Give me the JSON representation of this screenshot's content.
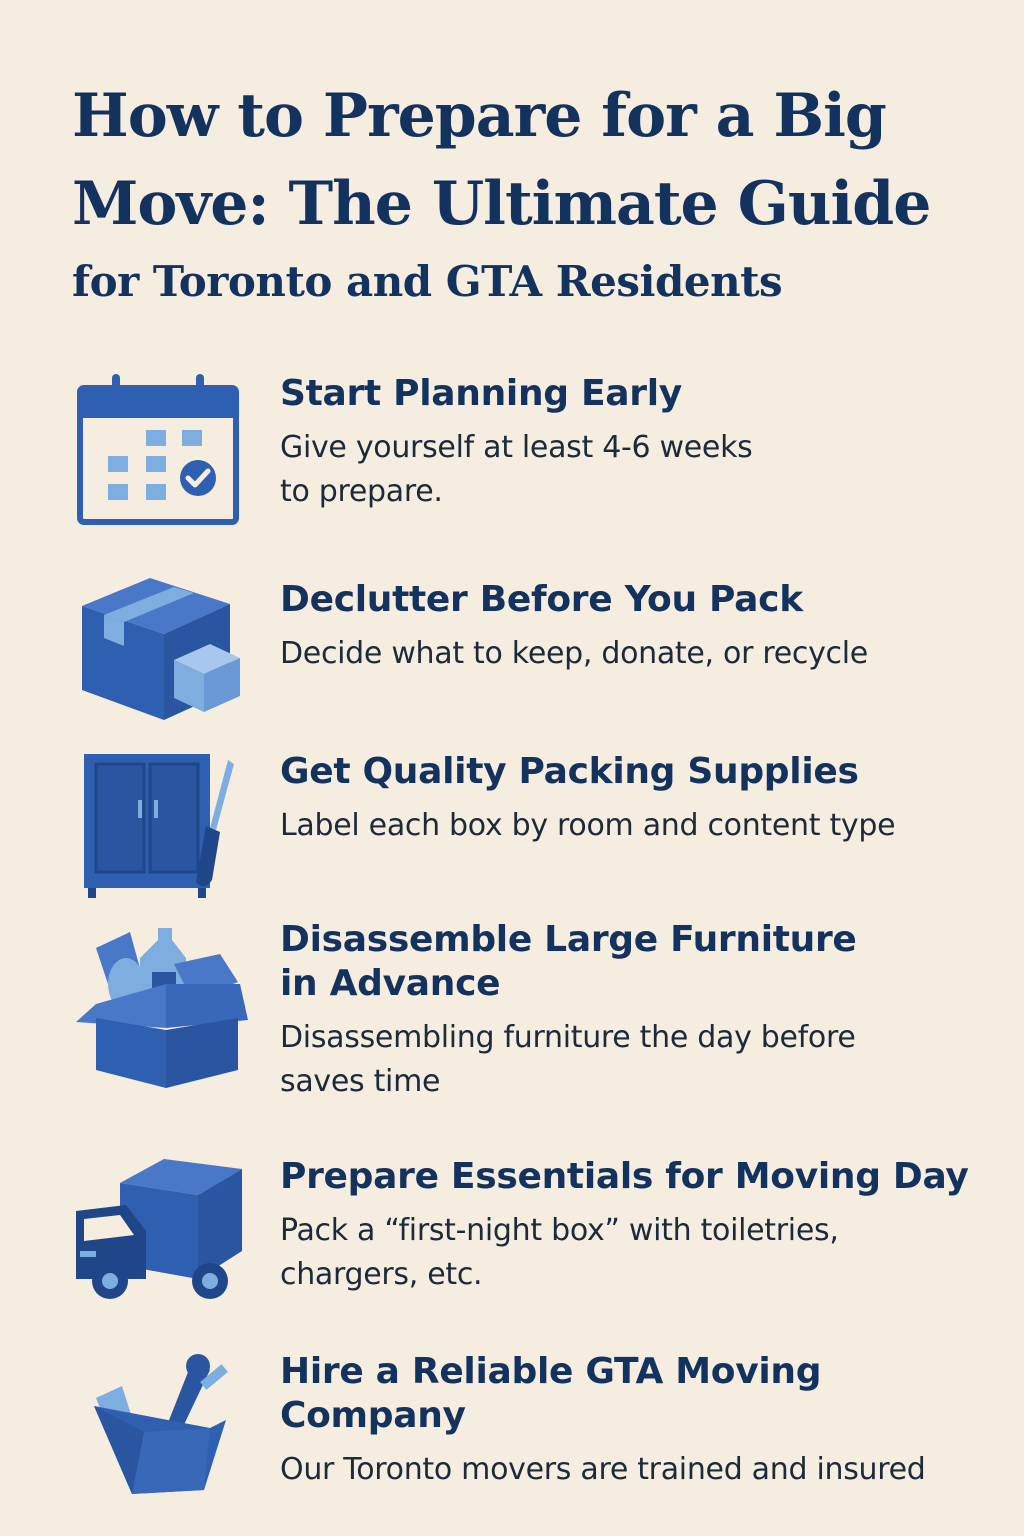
{
  "header": {
    "title_line1": "How to Prepare for a Big",
    "title_line2": "Move: The Ultimate Guide",
    "subtitle": "for Toronto and GTA Residents"
  },
  "colors": {
    "background": "#f6ede1",
    "heading": "#14325e",
    "icon_dark": "#2f5fb0",
    "icon_light": "#7eaee0"
  },
  "steps": [
    {
      "icon": "calendar-icon",
      "title": "Start Planning Early",
      "description_line1": "Give yourself at least 4-6 weeks",
      "description_line2": "to prepare."
    },
    {
      "icon": "boxes-icon",
      "title": "Declutter Before You Pack",
      "description_line1": "Decide what to keep, donate, or recycle"
    },
    {
      "icon": "cabinet-screwdriver-icon",
      "title": "Get Quality Packing Supplies",
      "description_line1": "Label each box by room and content type"
    },
    {
      "icon": "open-box-icon",
      "title_line1": "Disassemble Large Furniture",
      "title_line2": "in Advance",
      "description_line1": "Disassembling furniture the day before",
      "description_line2": "saves time"
    },
    {
      "icon": "moving-truck-icon",
      "title": "Prepare Essentials for Moving Day",
      "description_line1": "Pack a “first-night box” with toiletries,",
      "description_line2": "chargers, etc."
    },
    {
      "icon": "tools-box-icon",
      "title_line1": "Hire a Reliable GTA Moving",
      "title_line2": "Company",
      "description_line1": "Our Toronto movers are trained and insured"
    }
  ]
}
